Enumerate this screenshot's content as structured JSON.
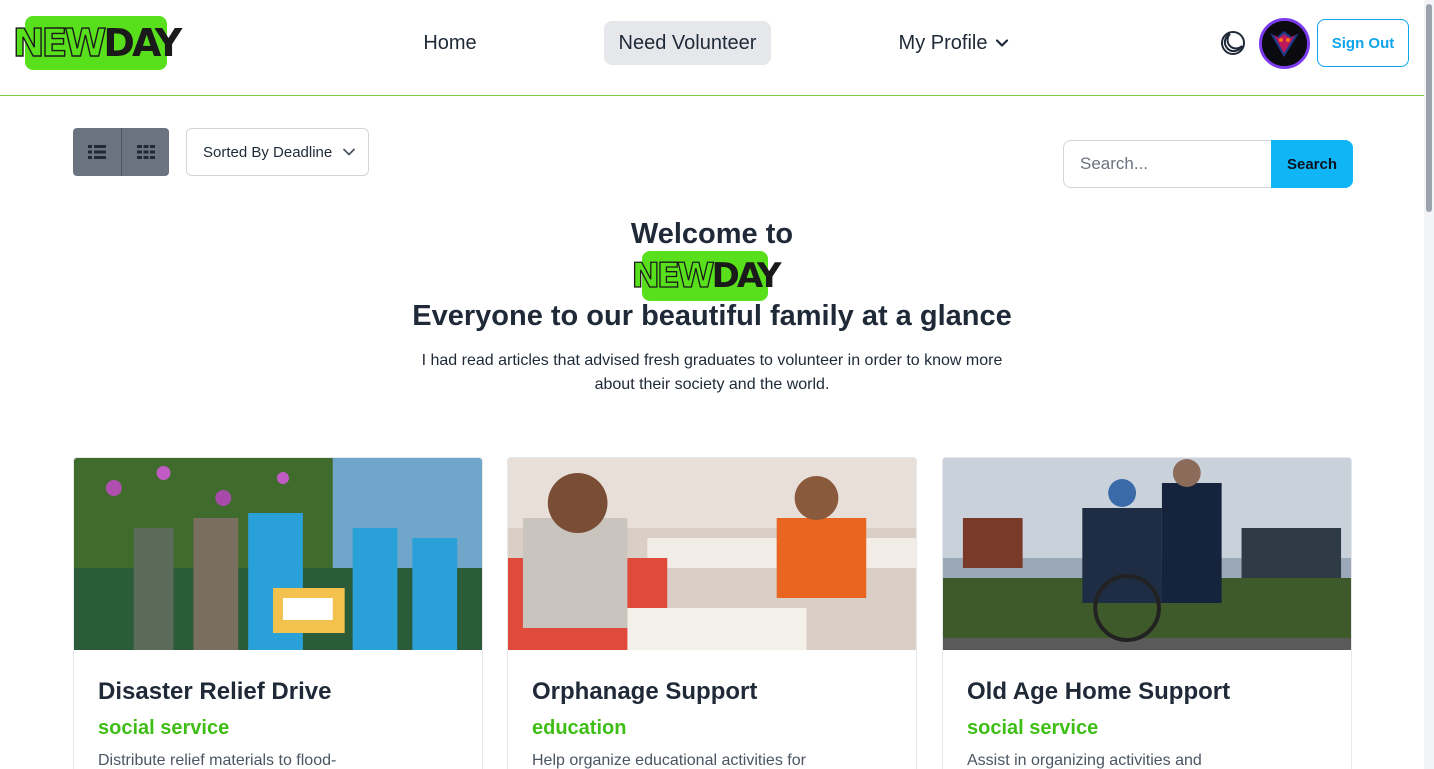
{
  "brand": {
    "logo_new": "NEW",
    "logo_day": "DAY"
  },
  "nav": {
    "home": "Home",
    "need_volunteer": "Need Volunteer",
    "my_profile": "My Profile",
    "sign_out": "Sign Out"
  },
  "toolbar": {
    "sort_label": "Sorted By Deadline",
    "search_placeholder": "Search...",
    "search_button": "Search"
  },
  "hero": {
    "welcome": "Welcome to",
    "logo_new": "NEW",
    "logo_day": "DAY",
    "title": "Everyone to our beautiful family at a glance",
    "description": "I had read articles that advised fresh graduates to volunteer in order to know more about their society and the world."
  },
  "cards": [
    {
      "title": "Disaster Relief Drive",
      "category": "social service",
      "description": "Distribute relief materials to flood-"
    },
    {
      "title": "Orphanage Support",
      "category": "education",
      "description": "Help organize educational activities for"
    },
    {
      "title": "Old Age Home Support",
      "category": "social service",
      "description": "Assist in organizing activities and"
    }
  ],
  "icons": {
    "list_view": "list-icon",
    "grid_view": "grid-icon",
    "theme": "moon-icon",
    "dropdown": "chevron-down-icon"
  },
  "colors": {
    "brand_green": "#58e01c",
    "accent_blue": "#0fb5f5",
    "category_green": "#3fbf16",
    "avatar_ring": "#7c3aed"
  }
}
